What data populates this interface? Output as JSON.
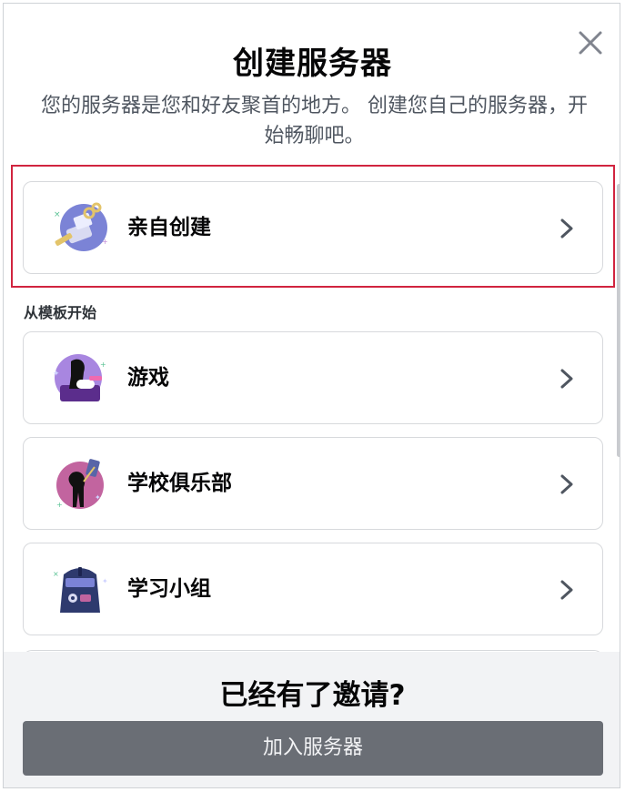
{
  "modal": {
    "title": "创建服务器",
    "subtitle": "您的服务器是您和好友聚首的地方。 创建您自己的服务器，开始畅聊吧。",
    "close_icon": "close-icon"
  },
  "create_own": {
    "label": "亲自创建",
    "icon": "create-own-illustration-icon"
  },
  "templates": {
    "section_label": "从模板开始",
    "items": [
      {
        "label": "游戏",
        "icon": "gaming-illustration-icon"
      },
      {
        "label": "学校俱乐部",
        "icon": "school-club-illustration-icon"
      },
      {
        "label": "学习小组",
        "icon": "study-group-illustration-icon"
      }
    ]
  },
  "footer": {
    "title": "已经有了邀请?",
    "join_button": "加入服务器"
  },
  "colors": {
    "highlight_border": "#d1243f",
    "button_bg": "#6a6e75",
    "footer_bg": "#f2f3f5"
  }
}
